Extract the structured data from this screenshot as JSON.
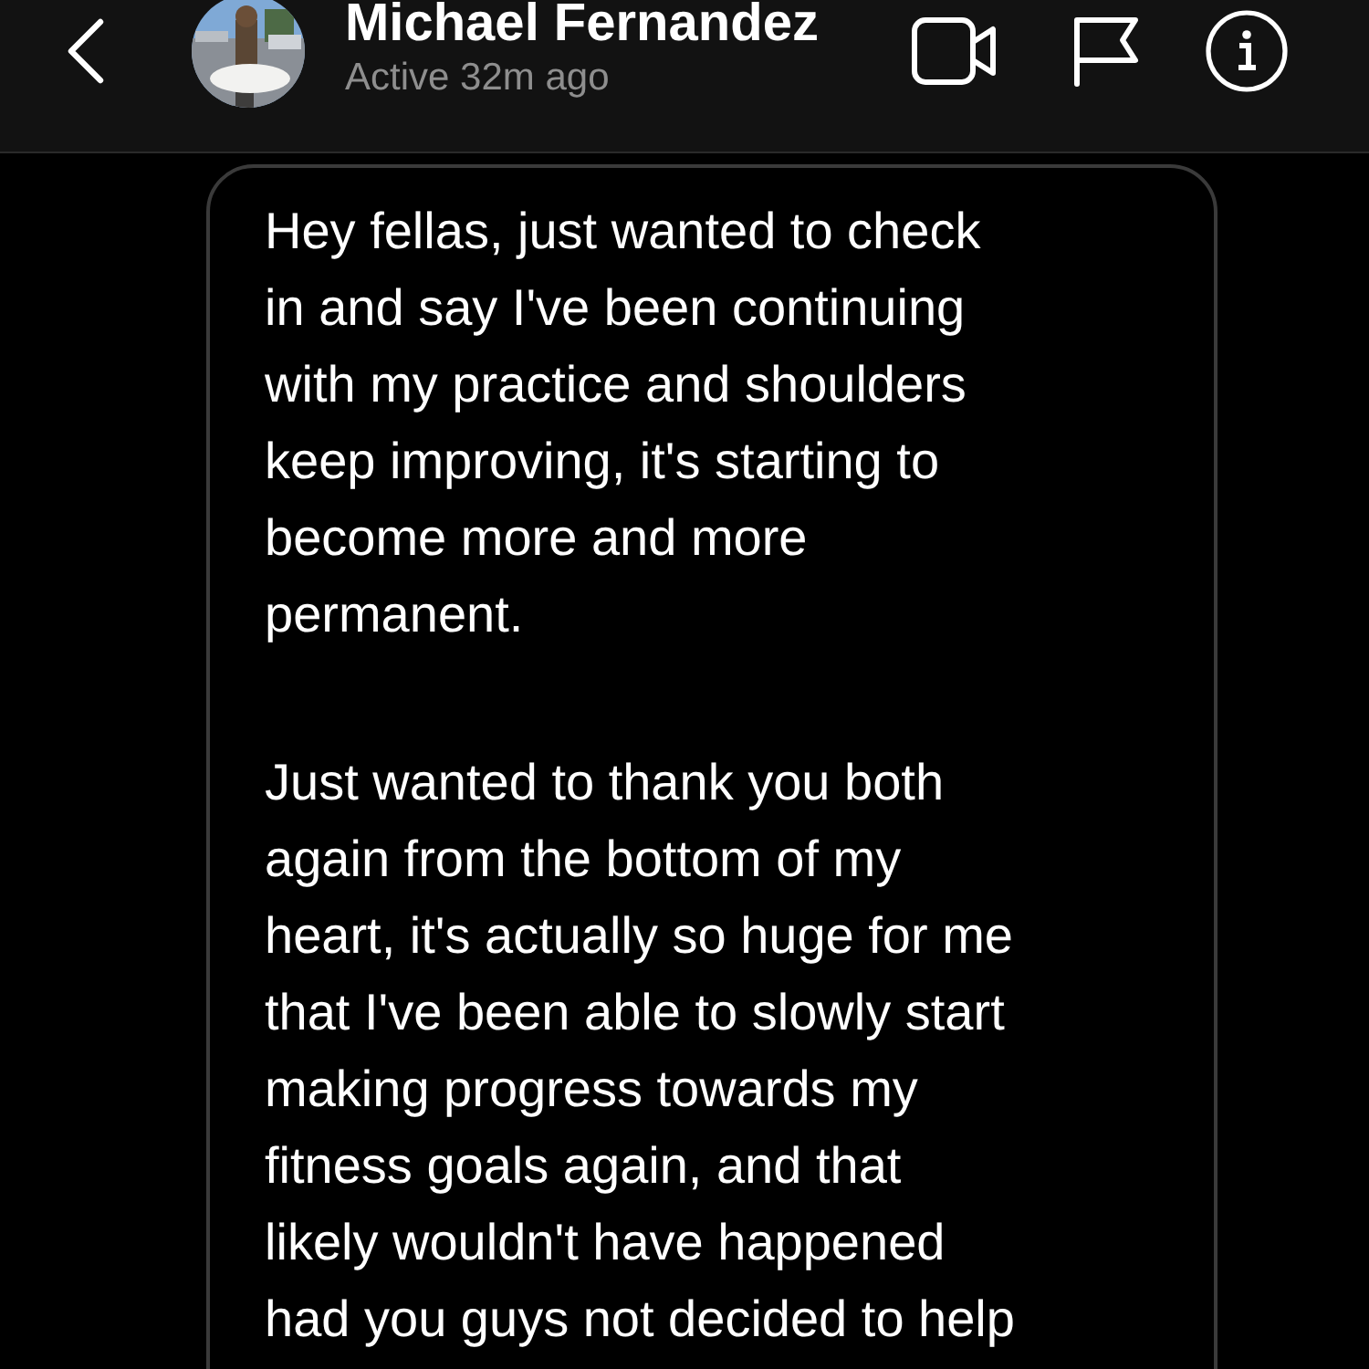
{
  "header": {
    "name": "Michael Fernandez",
    "status": "Active 32m ago"
  },
  "messages": [
    {
      "paragraphs": [
        "Hey fellas, just wanted to check\nin and say I've been continuing\nwith my practice and shoulders\nkeep improving, it's starting to\nbecome more and more\npermanent.",
        "Just wanted to thank you both\nagain from the bottom of my\nheart, it's actually so huge for me\nthat I've been able to slowly start\nmaking progress towards my\nfitness goals again, and that\nlikely wouldn't have happened\nhad you guys not decided to help"
      ]
    }
  ]
}
